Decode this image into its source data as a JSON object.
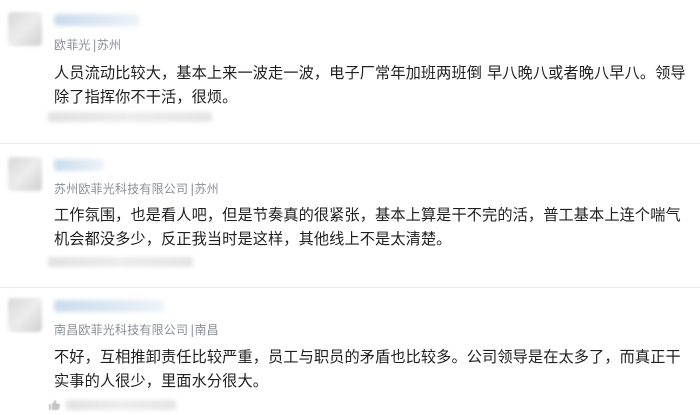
{
  "reviews": [
    {
      "company": "欧菲光",
      "location": "|苏州",
      "text": "人员流动比较大，基本上来一波走一波，电子厂常年加班两班倒 早八晚八或者晚八早八。领导除了指挥你不干活，很烦。"
    },
    {
      "company": "苏州欧菲光科技有限公司",
      "location": "|苏州",
      "text": "工作氛围，也是看人吧，但是节奏真的很紧张，基本上算是干不完的活，普工基本上连个喘气机会都没多少，反正我当时是这样，其他线上不是太清楚。"
    },
    {
      "company": "南昌欧菲光科技有限公司",
      "location": "|南昌",
      "text": "不好，互相推卸责任比较严重，员工与职员的矛盾也比较多。公司领导是在太多了，而真正干实事的人很少，里面水分很大。"
    }
  ],
  "icons": {
    "like": "thumb-up-icon"
  }
}
